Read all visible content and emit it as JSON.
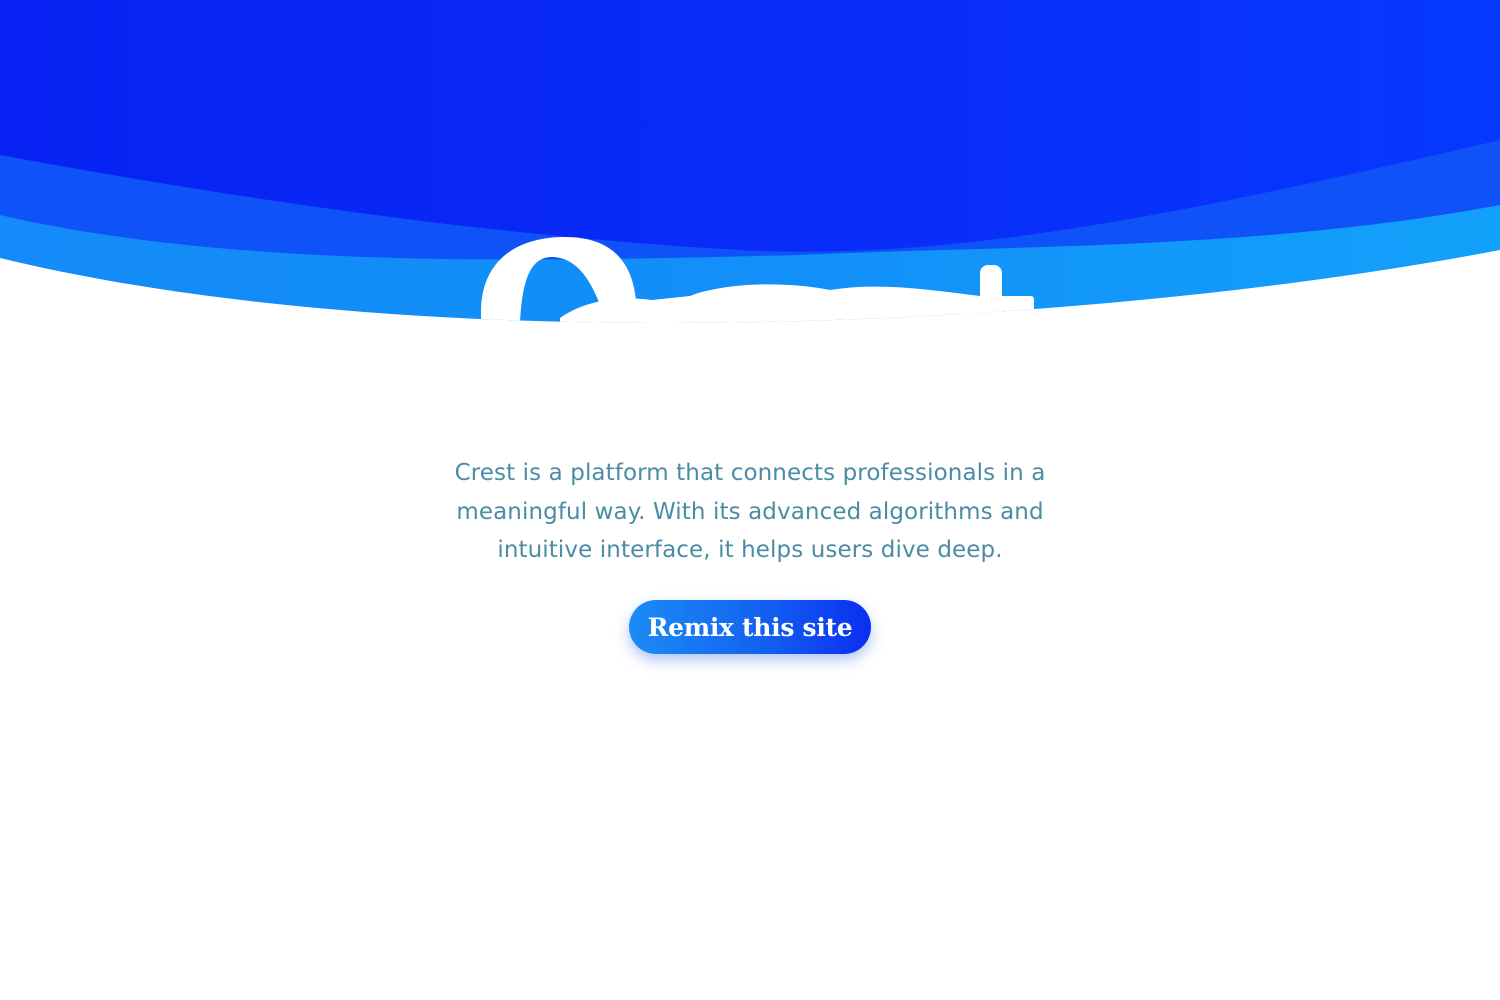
{
  "brand": {
    "name": "Crest"
  },
  "colors": {
    "wave_dark": "#0a2af5",
    "wave_mid": "#0f50f8",
    "wave_light": "#129cf9",
    "text": "#4b8ca5",
    "button_start": "#1b8cf5",
    "button_end": "#0a2ef0"
  },
  "hero": {
    "description": "Crest is a platform that connects professionals in a meaningful way. With its advanced algorithms and intuitive interface, it helps users dive deep."
  },
  "cta": {
    "label": "Remix this site"
  }
}
